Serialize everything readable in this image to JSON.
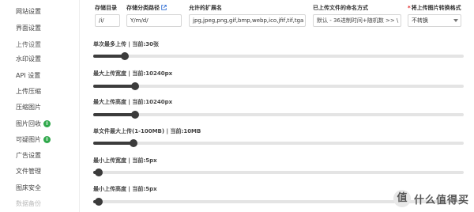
{
  "sidebar": {
    "items": [
      {
        "label": "网站设置",
        "badge": null
      },
      {
        "label": "界面设置",
        "badge": null
      },
      {
        "label": "上传设置",
        "badge": null
      },
      {
        "label": "水印设置",
        "badge": null
      },
      {
        "label": "API 设置",
        "badge": null
      },
      {
        "label": "上传压缩",
        "badge": null
      },
      {
        "label": "压缩图片",
        "badge": null
      },
      {
        "label": "图片回收",
        "badge": "0"
      },
      {
        "label": "可疑图片",
        "badge": "0"
      },
      {
        "label": "广告设置",
        "badge": null
      },
      {
        "label": "文件管理",
        "badge": null
      },
      {
        "label": "图床安全",
        "badge": null
      },
      {
        "label": "数据备份",
        "badge": null
      }
    ]
  },
  "fields": {
    "storage_dir": {
      "label": "存储目录",
      "value": "/i/"
    },
    "storage_path": {
      "label": "存储分类路径",
      "value": "Y/m/d/"
    },
    "allowed_ext": {
      "label": "允许的扩展名",
      "value": "jpg,jpeg,png,gif,bmp,webp,ico,jfif,tif,tga"
    },
    "naming": {
      "label": "已上传文件的命名方式",
      "value": "默认 - 36进制时间+随机数 >> \\"
    },
    "convert": {
      "label": "将上传图片转换格式",
      "required_mark": "*",
      "value": "不转换"
    }
  },
  "sliders": [
    {
      "label": "单次最多上传 | 当前:30张",
      "value": 30,
      "min": 0,
      "max": 400
    },
    {
      "label": "最大上传宽度 | 当前:10240px",
      "value": 10240,
      "min": 0,
      "max": 100000
    },
    {
      "label": "最大上传高度 | 当前:10240px",
      "value": 10240,
      "min": 0,
      "max": 100000
    },
    {
      "label": "单文件最大上传(1-100MB) | 当前:10MB",
      "value": 10,
      "min": 0,
      "max": 100
    },
    {
      "label": "最小上传宽度 | 当前:5px",
      "value": 5,
      "min": 0,
      "max": 1000
    },
    {
      "label": "最小上传高度 | 当前:5px",
      "value": 5,
      "min": 0,
      "max": 1000
    }
  ],
  "watermark": {
    "text": "什么值得买"
  },
  "icons": [
    "external-link-icon",
    "chevron-down-icon",
    "watermark-logo-icon"
  ]
}
